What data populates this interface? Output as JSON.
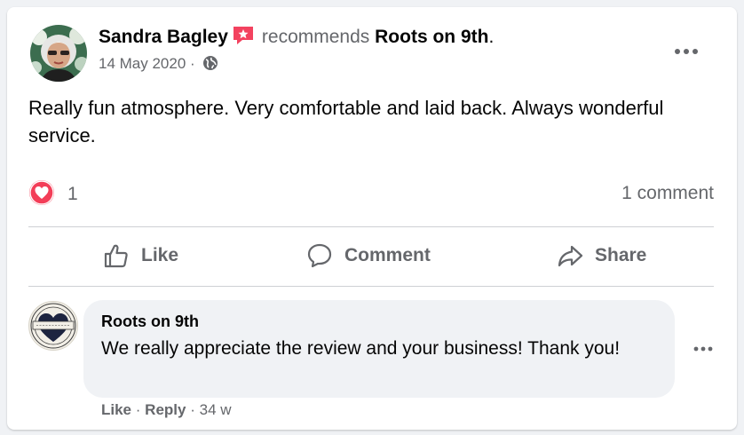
{
  "post": {
    "author": "Sandra Bagley",
    "recommends_word": "recommends",
    "page_name": "Roots on 9th",
    "period": ".",
    "date": "14 May 2020",
    "date_separator": "·",
    "audience_icon": "globe-icon",
    "text": "Really fun atmosphere.  Very comfortable and laid back.  Always wonderful service.",
    "reaction_icon": "love-reaction-icon",
    "reaction_count": "1",
    "comment_count": "1 comment"
  },
  "actions": {
    "like": "Like",
    "comment": "Comment",
    "share": "Share"
  },
  "comment": {
    "author": "Roots on 9th",
    "text": "We really appreciate the review and your business! Thank you!",
    "like": "Like",
    "reply": "Reply",
    "separator": "·",
    "age": "34 w"
  },
  "colors": {
    "background": "#f0f2f5",
    "card": "#ffffff",
    "secondary_text": "#65676b",
    "love_red": "#f33e58",
    "recommend_badge": "#f3425f"
  }
}
